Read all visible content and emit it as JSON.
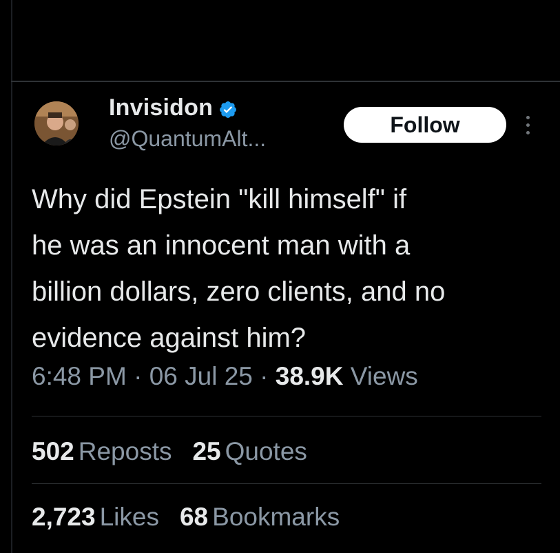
{
  "author": {
    "display_name": "Invisidon",
    "handle": "@QuantumAlt...",
    "verified": true,
    "avatar_icon": "avatar-photo"
  },
  "follow_label": "Follow",
  "more_icon": "more-options-icon",
  "tweet": {
    "text": "Why did Epstein \"kill himself\" if\nhe was an innocent man with a\nbillion dollars, zero clients, and no\nevidence against him?"
  },
  "meta": {
    "time": "6:48 PM",
    "dot1": "·",
    "date": "06 Jul 25",
    "dot2": "·",
    "views_count": "38.9K",
    "views_label": "Views"
  },
  "stats_row1": {
    "reposts_count": "502",
    "reposts_label": "Reposts",
    "quotes_count": "25",
    "quotes_label": "Quotes"
  },
  "stats_row2": {
    "likes_count": "2,723",
    "likes_label": "Likes",
    "bookmarks_count": "68",
    "bookmarks_label": "Bookmarks"
  },
  "colors": {
    "background": "#000000",
    "text_primary": "#e7e9ea",
    "text_secondary": "#8b98a5",
    "verified_blue": "#1d9bf0",
    "divider": "#2f3336"
  }
}
